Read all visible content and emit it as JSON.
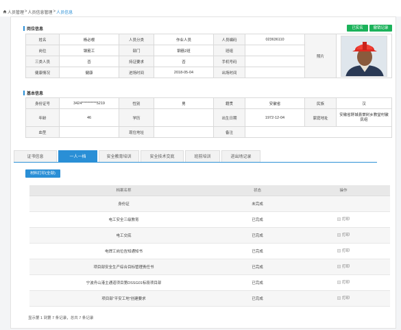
{
  "breadcrumb": {
    "items": [
      "人员管理",
      "人员信息管理",
      "人员信息"
    ],
    "sep": ">"
  },
  "sections": {
    "post": "岗位信息",
    "basic": "基本信息"
  },
  "buttons": {
    "realname": "已实名",
    "cancel_record": "撤销记录",
    "print_all": "材料打印(全部)"
  },
  "post_info": {
    "name_label": "姓名",
    "name": "杨必根",
    "category_label": "人员分类",
    "category": "作业人员",
    "code_label": "人员编码",
    "code": "023636110",
    "post_label": "岗位",
    "post": "钢筋工",
    "dept_label": "部门",
    "dept": "钢筋2班",
    "team_label": "班组",
    "team": "",
    "three_label": "三类人员",
    "three": "否",
    "cert_label": "持证要求",
    "cert": "否",
    "phone_label": "手机号码",
    "phone": "",
    "health_label": "健康情况",
    "health": "健康",
    "enter_label": "进场时间",
    "enter": "2018-05-04",
    "exit_label": "出场时间",
    "exit": "",
    "photo_label": "照片"
  },
  "basic_info": {
    "id_label": "身份证号",
    "id": "3424**********5219",
    "sex_label": "性别",
    "sex": "男",
    "origin_label": "籍贯",
    "origin": "安徽省",
    "nation_label": "民族",
    "nation": "汉",
    "age_label": "年龄",
    "age": "46",
    "edu_label": "学历",
    "edu": "",
    "birth_label": "出生日期",
    "birth": "1972-12-04",
    "address_label": "家庭地址",
    "address": "安徽省舒城县棠树乡教堂村徽民组",
    "blood_label": "血型",
    "blood": "",
    "residence_label": "现住地址",
    "residence": "",
    "remark_label": "备注",
    "remark": ""
  },
  "tabs": [
    {
      "label": "证书信息",
      "active": false
    },
    {
      "label": "一人一档",
      "active": true
    },
    {
      "label": "安全教育培训",
      "active": false
    },
    {
      "label": "安全技术交底",
      "active": false
    },
    {
      "label": "班前培训",
      "active": false
    },
    {
      "label": "进出场记录",
      "active": false
    }
  ],
  "list": {
    "headers": [
      "档案名称",
      "状态",
      "操作"
    ],
    "rows": [
      {
        "name": "身份证",
        "status": "未完成",
        "action": ""
      },
      {
        "name": "电工安全三级教育",
        "status": "已完成",
        "action": "打印"
      },
      {
        "name": "电工交底",
        "status": "已完成",
        "action": "打印"
      },
      {
        "name": "电焊工岗位告知通知书",
        "status": "已完成",
        "action": "打印"
      },
      {
        "name": "项目部安全生产综合目标管理责任书",
        "status": "已完成",
        "action": "打印"
      },
      {
        "name": "宁波舟山港主通道项目第DSSG01标段项目部",
        "status": "已完成",
        "action": "打印"
      },
      {
        "name": "项目部“平安工地”创建要求",
        "status": "已完成",
        "action": "打印"
      }
    ]
  },
  "footer": "显示第 1 到第 7 条记录，总共 7 条记录",
  "colors": {
    "accent": "#2a8fd6",
    "green": "#1bb25a"
  },
  "icons": {
    "home": "home-icon",
    "print": "print-icon"
  }
}
